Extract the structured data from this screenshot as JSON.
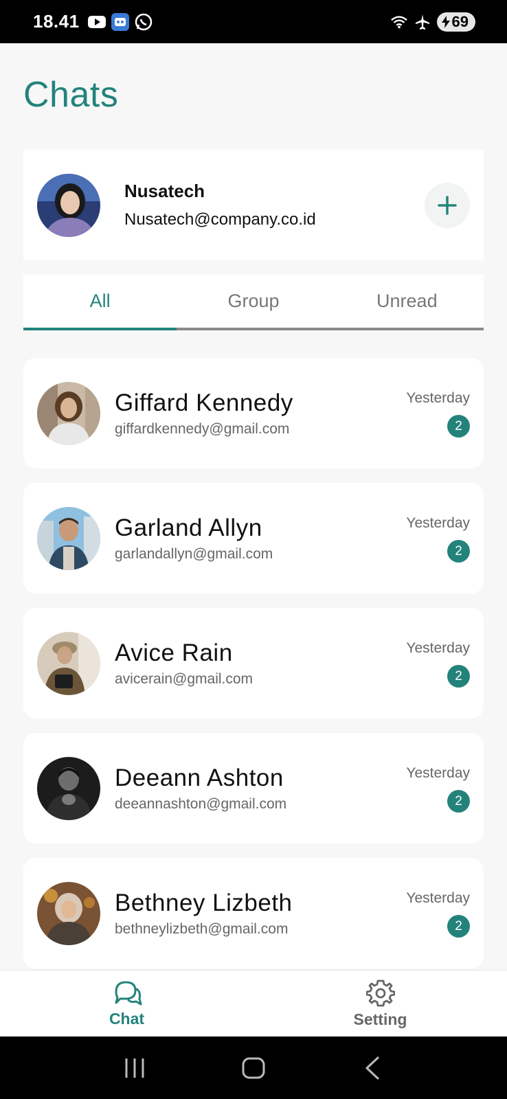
{
  "status_bar": {
    "time": "18.41",
    "battery": "69",
    "left_icons": [
      "youtube-icon",
      "app-icon",
      "whatsapp-icon"
    ],
    "right_icons": [
      "wifi-icon",
      "airplane-icon",
      "battery-icon"
    ]
  },
  "page": {
    "title": "Chats"
  },
  "profile": {
    "name": "Nusatech",
    "email": "Nusatech@company.co.id",
    "add_icon": "plus-icon"
  },
  "tabs": [
    {
      "label": "All",
      "active": true
    },
    {
      "label": "Group",
      "active": false
    },
    {
      "label": "Unread",
      "active": false
    }
  ],
  "chats": [
    {
      "name": "Giffard Kennedy",
      "email": "giffardkennedy@gmail.com",
      "time": "Yesterday",
      "unread": "2"
    },
    {
      "name": "Garland Allyn",
      "email": "garlandallyn@gmail.com",
      "time": "Yesterday",
      "unread": "2"
    },
    {
      "name": "Avice Rain",
      "email": "avicerain@gmail.com",
      "time": "Yesterday",
      "unread": "2"
    },
    {
      "name": "Deeann Ashton",
      "email": "deeannashton@gmail.com",
      "time": "Yesterday",
      "unread": "2"
    },
    {
      "name": "Bethney Lizbeth",
      "email": "bethneylizbeth@gmail.com",
      "time": "Yesterday",
      "unread": "2"
    }
  ],
  "bottom_nav": [
    {
      "label": "Chat",
      "icon": "chat-bubbles-icon",
      "active": true
    },
    {
      "label": "Setting",
      "icon": "gear-icon",
      "active": false
    }
  ],
  "colors": {
    "accent": "#23837b",
    "background": "#f7f7f7",
    "card": "#ffffff"
  }
}
